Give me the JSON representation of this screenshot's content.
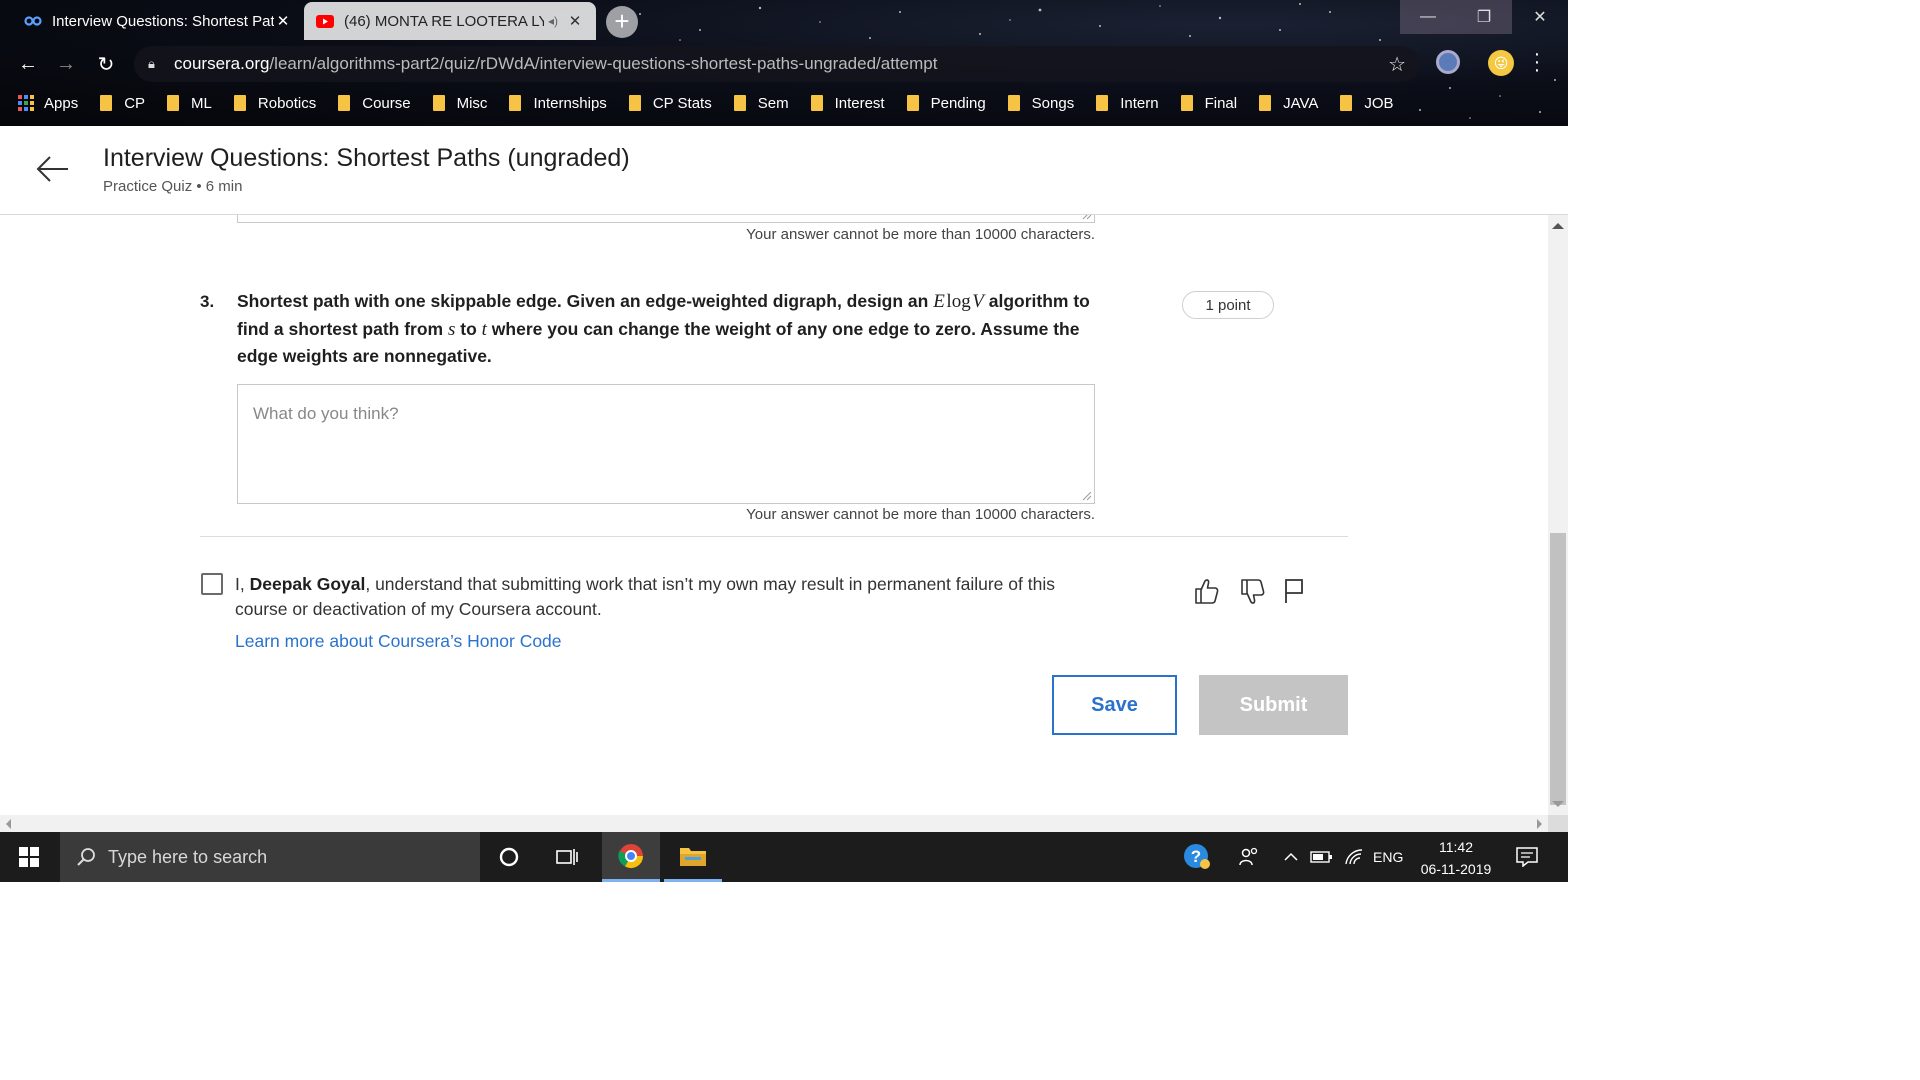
{
  "browser": {
    "tabs": [
      {
        "title": "Interview Questions: Shortest Pat",
        "active": true
      },
      {
        "title": "(46) MONTA RE LOOTERA LY",
        "active": false
      }
    ],
    "url_host": "coursera.org",
    "url_path": "/learn/algorithms-part2/quiz/rDWdA/interview-questions-shortest-paths-ungraded/attempt",
    "bookmarks": [
      "Apps",
      "CP",
      "ML",
      "Robotics",
      "Course",
      "Misc",
      "Internships",
      "CP Stats",
      "Sem",
      "Interest",
      "Pending",
      "Songs",
      "Intern",
      "Final",
      "JAVA",
      "JOB"
    ]
  },
  "header": {
    "title": "Interview Questions: Shortest Paths (ungraded)",
    "subtitle": "Practice Quiz • 6 min"
  },
  "quiz": {
    "char_limit_hint": "Your answer cannot be more than 10000 characters.",
    "question": {
      "number": "3.",
      "text_part1": "Shortest path with one skippable edge. Given an edge-weighted digraph, design an ",
      "math_E": "E",
      "math_log": "log",
      "math_V": "V",
      "text_part2": " algorithm to find a shortest path from ",
      "math_s": "s",
      "text_to": " to ",
      "math_t": "t",
      "text_part3": " where you can change the weight of any one edge to zero. Assume the edge weights are nonnegative.",
      "points": "1 point",
      "answer_placeholder": "What do you think?"
    },
    "honor": {
      "prefix": "I, ",
      "name": "Deepak Goyal",
      "text": ", understand that submitting work that isn’t my own may result in permanent failure of this course or deactivation of my Coursera account.",
      "link": "Learn more about Coursera’s Honor Code"
    },
    "buttons": {
      "save": "Save",
      "submit": "Submit"
    }
  },
  "taskbar": {
    "search_placeholder": "Type here to search",
    "language": "ENG",
    "time": "11:42",
    "date": "06-11-2019"
  },
  "colors": {
    "accent": "#2a73cc",
    "submit_disabled": "#c4c4c4",
    "bookmark_folder": "#f6c344"
  }
}
